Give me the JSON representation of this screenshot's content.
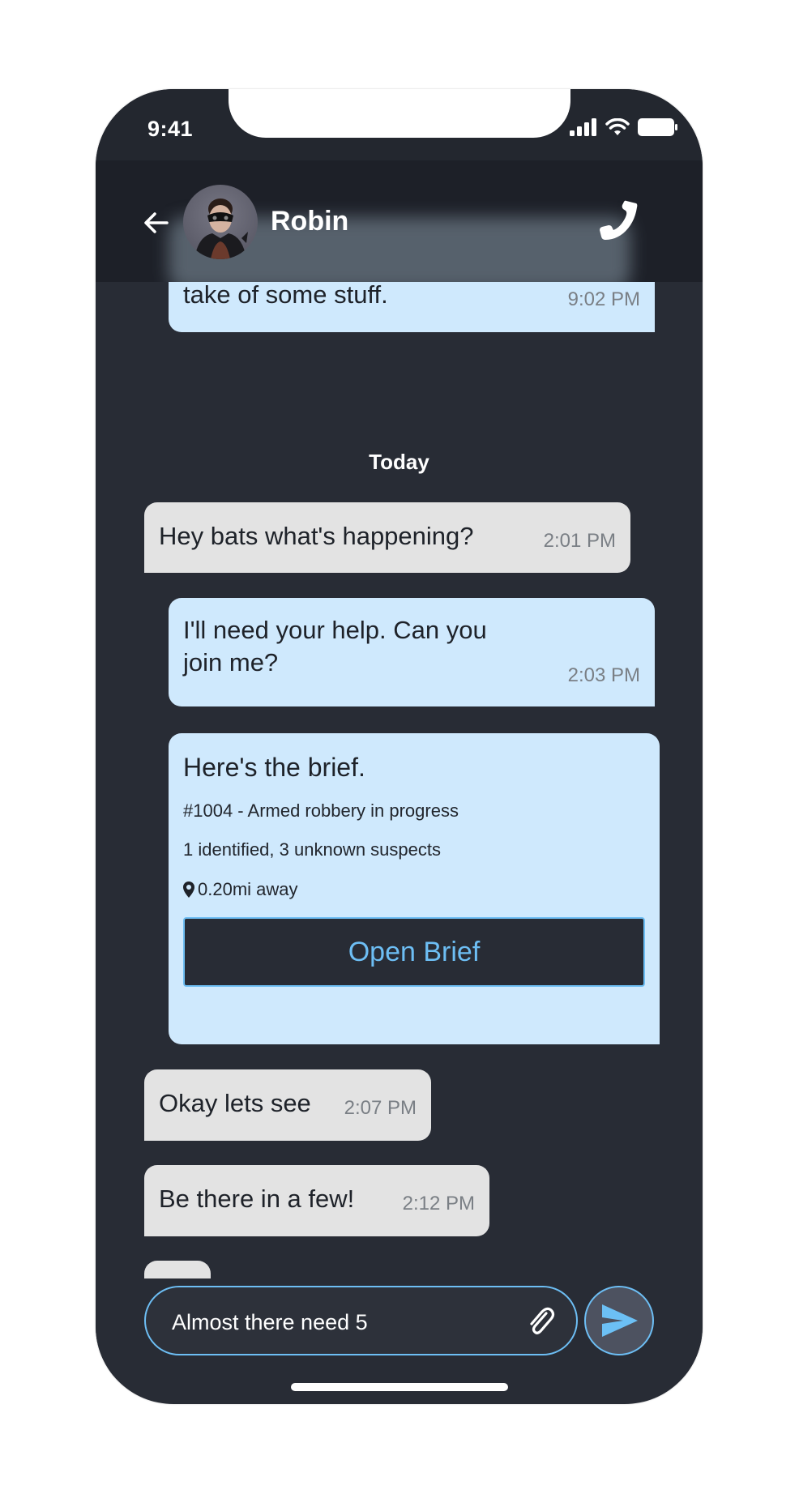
{
  "status_bar": {
    "time": "9:41"
  },
  "header": {
    "contact_name": "Robin",
    "back_icon": "arrow-left-icon",
    "call_icon": "phone-icon"
  },
  "messages": {
    "partial": {
      "text": "take of some stuff.",
      "time": "9:02 PM",
      "direction": "outgoing"
    },
    "day_separator": "Today",
    "items": [
      {
        "text": "Hey bats what's happening?",
        "time": "2:01 PM",
        "direction": "incoming"
      },
      {
        "text": "I'll need your help. Can you join me?",
        "time": "2:03 PM",
        "direction": "outgoing"
      }
    ],
    "brief": {
      "title": "Here's the brief.",
      "case": "#1004 - Armed robbery in progress",
      "suspects": "1 identified, 3 unknown suspects",
      "distance": "0.20mi away",
      "button_label": "Open Brief",
      "direction": "outgoing"
    },
    "later": [
      {
        "text": "Okay lets see",
        "time": "2:07 PM",
        "direction": "incoming"
      },
      {
        "text": "Be there in a few!",
        "time": "2:12 PM",
        "direction": "incoming"
      }
    ],
    "typing_indicator": ". . ."
  },
  "composer": {
    "value": "Almost there need 5",
    "attach_icon": "paperclip-icon",
    "send_icon": "send-icon"
  },
  "colors": {
    "background": "#282c35",
    "header": "#1d2028",
    "outgoing_bubble": "#cfe9fd",
    "incoming_bubble": "#e3e3e3",
    "accent": "#6dbef4"
  }
}
